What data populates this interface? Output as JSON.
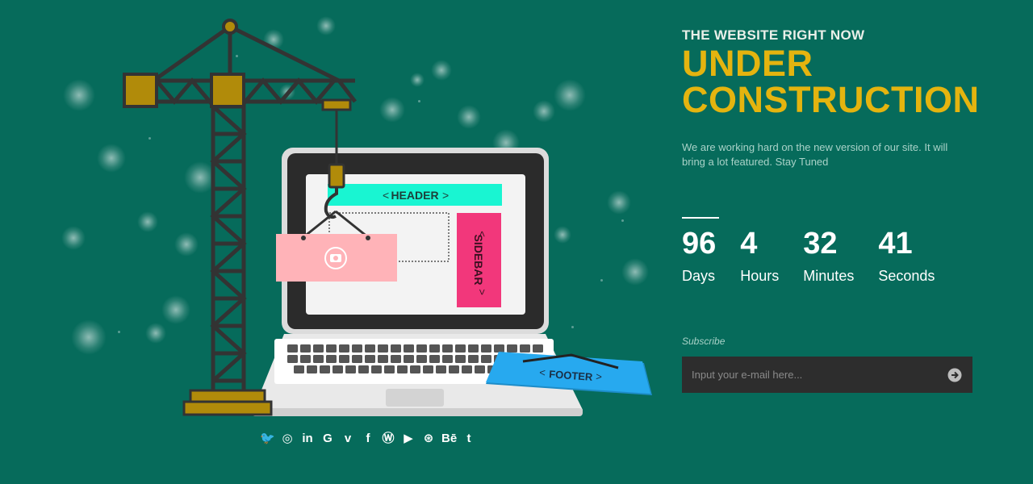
{
  "hero": {
    "kicker": "THE WEBSITE RIGHT NOW",
    "headline_line1": "UNDER",
    "headline_line2": "CONSTRUCTION",
    "description": "We are working hard on the new version of our site. It will bring a lot featured. Stay Tuned"
  },
  "countdown": [
    {
      "value": "96",
      "label": "Days"
    },
    {
      "value": "4",
      "label": "Hours"
    },
    {
      "value": "32",
      "label": "Minutes"
    },
    {
      "value": "41",
      "label": "Seconds"
    }
  ],
  "subscribe": {
    "label": "Subscribe",
    "placeholder": "Input your e-mail here...",
    "submit_icon": "arrow-right-circle-icon"
  },
  "illustration": {
    "header_label": "HEADER",
    "sidebar_label": "SIDEBAR",
    "footer_label": "FOOTER"
  },
  "social": [
    {
      "icon": "twitter-icon",
      "glyph": "🐦"
    },
    {
      "icon": "instagram-icon",
      "glyph": "◎"
    },
    {
      "icon": "linkedin-icon",
      "glyph": "in"
    },
    {
      "icon": "google-icon",
      "glyph": "G"
    },
    {
      "icon": "vimeo-icon",
      "glyph": "v"
    },
    {
      "icon": "facebook-icon",
      "glyph": "f"
    },
    {
      "icon": "wordpress-icon",
      "glyph": "Ⓦ"
    },
    {
      "icon": "youtube-icon",
      "glyph": "▶"
    },
    {
      "icon": "dribbble-icon",
      "glyph": "⊛"
    },
    {
      "icon": "behance-icon",
      "glyph": "Bē"
    },
    {
      "icon": "tumblr-icon",
      "glyph": "t"
    }
  ],
  "colors": {
    "background": "#066b5b",
    "accent": "#e4b40f",
    "header_bar": "#19f5d2",
    "sidebar": "#f2377b",
    "footer_card": "#27a9ef",
    "photo_card": "#ffb3b8"
  }
}
